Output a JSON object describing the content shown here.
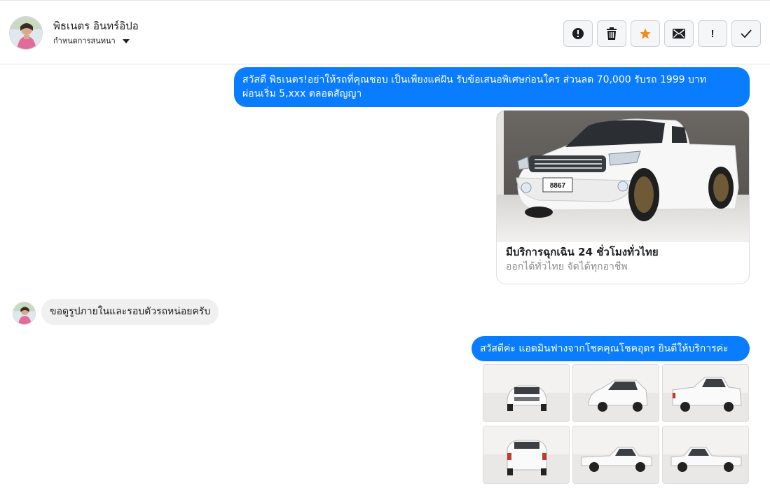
{
  "header": {
    "contact_name": "พิธเนตร อินทร์อิปอ",
    "assign_label": "กำหนดการสนทนา",
    "actions": [
      {
        "icon": "alert-circle-icon"
      },
      {
        "icon": "trash-icon"
      },
      {
        "icon": "star-icon"
      },
      {
        "icon": "envelope-icon"
      },
      {
        "icon": "exclamation-icon",
        "glyph": "!"
      },
      {
        "icon": "checkmark-icon"
      }
    ]
  },
  "messages": {
    "outgoing_1": {
      "line1": "สวัสดี พิธเนตร!อย่าให้รถที่คุณชอบ เป็นเพียงแค่ฝัน รับข้อเสนอพิเศษก่อนใคร ส่วนลด 70,000  รับรถ 1999 บาท",
      "line2": "ผ่อนเริ่ม 5,xxx ตลอดสัญญา"
    },
    "card": {
      "plate": "8867",
      "title": "มีบริการฉุกเฉิน 24 ชั่วโมงทั่วไทย",
      "subtitle": "ออกได้ทั่วไทย จัดได้ทุกอาชีพ"
    },
    "incoming_1": "ขอดูรูปภายในและรอบตัวรถหน่อยครับ",
    "outgoing_2": "สวัสดีค่ะ แอดมินฟางจากโชคคุณโชคอุดร ยินดีให้บริการค่ะ"
  },
  "colors": {
    "accent": "#0a7cff",
    "star": "#f28b1e",
    "incoming_bubble": "#f0f0f0"
  }
}
